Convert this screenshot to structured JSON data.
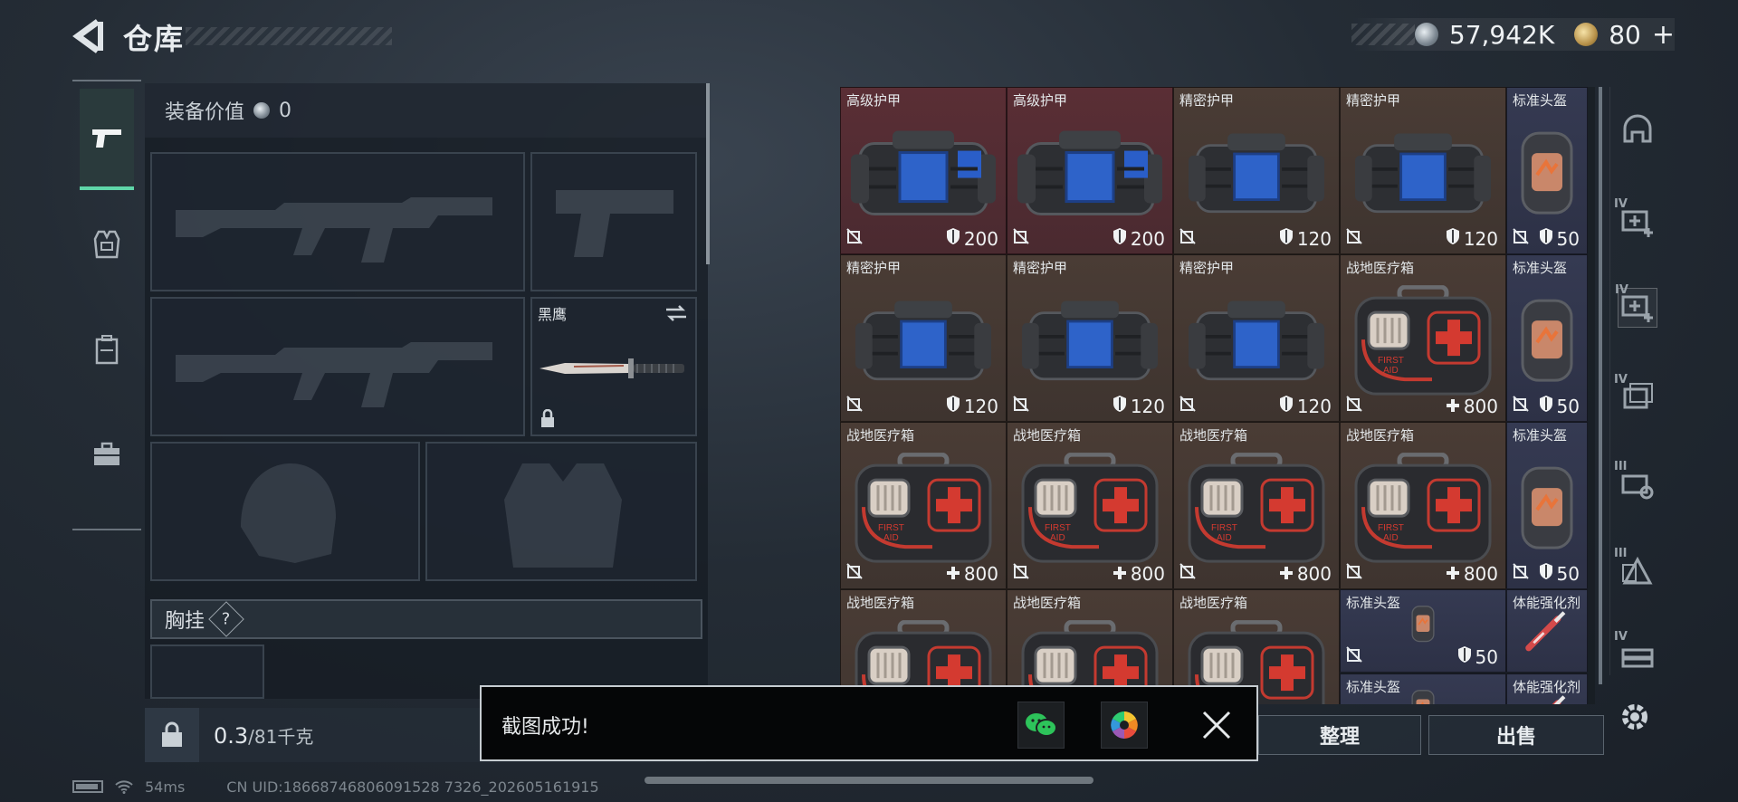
{
  "header": {
    "title": "仓库",
    "currency_silver": "57,942K",
    "currency_gold": "80",
    "currency_add": "+"
  },
  "left_nav": [
    {
      "id": "weapons",
      "icon": "pistol-icon",
      "active": true
    },
    {
      "id": "armor",
      "icon": "vest-icon",
      "active": false
    },
    {
      "id": "backpack",
      "icon": "backpack-icon",
      "active": false
    },
    {
      "id": "supplies",
      "icon": "briefcase-icon",
      "active": false
    }
  ],
  "loadout": {
    "equip_value_label": "装备价值",
    "equip_value": "0",
    "melee_label": "黑鹰",
    "chest_rig_label": "胸挂",
    "chest_rig_help": "?",
    "weight_value": "0.3",
    "weight_unit": "/81千克"
  },
  "inventory": {
    "items": [
      {
        "name": "高级护甲",
        "stat": "200",
        "stat_icon": "shield",
        "type": "armor-advanced"
      },
      {
        "name": "高级护甲",
        "stat": "200",
        "stat_icon": "shield",
        "type": "armor-advanced"
      },
      {
        "name": "精密护甲",
        "stat": "120",
        "stat_icon": "shield",
        "type": "armor-precision"
      },
      {
        "name": "精密护甲",
        "stat": "120",
        "stat_icon": "shield",
        "type": "armor-precision"
      },
      {
        "name": "标准头盔",
        "stat": "50",
        "stat_icon": "shield",
        "type": "helmet"
      },
      {
        "name": "精密护甲",
        "stat": "120",
        "stat_icon": "shield",
        "type": "armor-precision"
      },
      {
        "name": "精密护甲",
        "stat": "120",
        "stat_icon": "shield",
        "type": "armor-precision"
      },
      {
        "name": "精密护甲",
        "stat": "120",
        "stat_icon": "shield",
        "type": "armor-precision"
      },
      {
        "name": "战地医疗箱",
        "stat": "800",
        "stat_icon": "plus",
        "type": "medkit"
      },
      {
        "name": "标准头盔",
        "stat": "50",
        "stat_icon": "shield",
        "type": "helmet"
      },
      {
        "name": "战地医疗箱",
        "stat": "800",
        "stat_icon": "plus",
        "type": "medkit"
      },
      {
        "name": "战地医疗箱",
        "stat": "800",
        "stat_icon": "plus",
        "type": "medkit"
      },
      {
        "name": "战地医疗箱",
        "stat": "800",
        "stat_icon": "plus",
        "type": "medkit"
      },
      {
        "name": "战地医疗箱",
        "stat": "800",
        "stat_icon": "plus",
        "type": "medkit"
      },
      {
        "name": "标准头盔",
        "stat": "50",
        "stat_icon": "shield",
        "type": "helmet"
      },
      {
        "name": "战地医疗箱",
        "stat": "",
        "stat_icon": "",
        "type": "medkit"
      },
      {
        "name": "战地医疗箱",
        "stat": "",
        "stat_icon": "",
        "type": "medkit"
      },
      {
        "name": "战地医疗箱",
        "stat": "",
        "stat_icon": "",
        "type": "medkit"
      },
      {
        "name": "标准头盔",
        "stat": "50",
        "stat_icon": "shield",
        "type": "helmet-small"
      },
      {
        "name": "体能强化剂",
        "stat": "",
        "stat_icon": "",
        "type": "injector"
      },
      {
        "name": "标准头盔",
        "stat": "",
        "stat_icon": "",
        "type": "helmet-small"
      },
      {
        "name": "体能强化剂",
        "stat": "",
        "stat_icon": "",
        "type": "injector"
      }
    ]
  },
  "right_tools": [
    {
      "icon": "helmet-icon",
      "tier": ""
    },
    {
      "icon": "medkit-add-icon",
      "tier": "IV"
    },
    {
      "icon": "medkit-add-icon",
      "tier": "IV"
    },
    {
      "icon": "cards-icon",
      "tier": "IV"
    },
    {
      "icon": "key-icon",
      "tier": "III"
    },
    {
      "icon": "triangle-icon",
      "tier": "III"
    },
    {
      "icon": "stack-icon",
      "tier": "IV"
    }
  ],
  "actions": {
    "organize": "整理",
    "sell": "出售"
  },
  "toast": {
    "message": "截图成功!"
  },
  "status": {
    "ping": "54ms",
    "uid": "CN UID:18668746806091528 7326_202605161915"
  },
  "colors": {
    "accent": "#5fd6a8",
    "armor_bg": "#5a2e35",
    "medical_bg": "#4a3c35",
    "helmet_bg": "#353a52"
  }
}
